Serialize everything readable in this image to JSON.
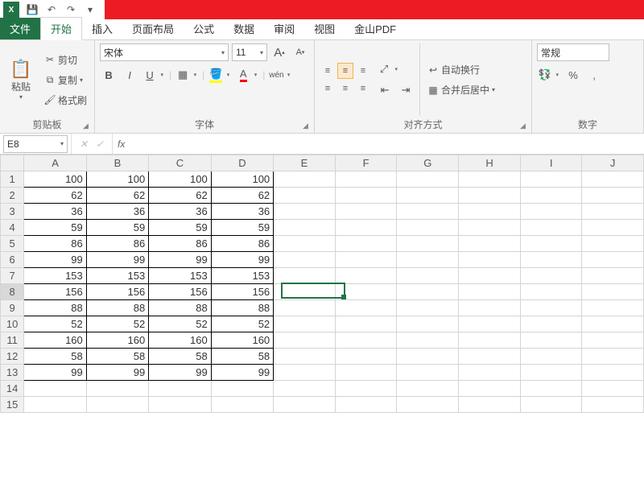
{
  "qat": {
    "save": "💾",
    "undo": "↶",
    "redo": "↷",
    "more": "▾"
  },
  "tabs": {
    "file": "文件",
    "items": [
      "开始",
      "插入",
      "页面布局",
      "公式",
      "数据",
      "审阅",
      "视图",
      "金山PDF"
    ],
    "active": 0
  },
  "ribbon": {
    "clipboard": {
      "label": "剪贴板",
      "paste": "粘贴",
      "cut": "剪切",
      "copy": "复制",
      "painter": "格式刷"
    },
    "font": {
      "label": "字体",
      "name": "宋体",
      "size": "11",
      "bold": "B",
      "italic": "I",
      "underline": "U",
      "pinyin": "wén"
    },
    "align": {
      "label": "对齐方式",
      "wrap": "自动换行",
      "merge": "合并后居中"
    },
    "number": {
      "label": "数字",
      "format": "常规",
      "percent": "%",
      "comma": ","
    }
  },
  "formula_bar": {
    "cell_ref": "E8",
    "value": ""
  },
  "grid": {
    "columns": [
      "A",
      "B",
      "C",
      "D",
      "E",
      "F",
      "G",
      "H",
      "I",
      "J"
    ],
    "row_count": 15,
    "selected_row": 8,
    "selected_col": 4,
    "data": [
      [
        100,
        100,
        100,
        100
      ],
      [
        62,
        62,
        62,
        62
      ],
      [
        36,
        36,
        36,
        36
      ],
      [
        59,
        59,
        59,
        59
      ],
      [
        86,
        86,
        86,
        86
      ],
      [
        99,
        99,
        99,
        99
      ],
      [
        153,
        153,
        153,
        153
      ],
      [
        156,
        156,
        156,
        156
      ],
      [
        88,
        88,
        88,
        88
      ],
      [
        52,
        52,
        52,
        52
      ],
      [
        160,
        160,
        160,
        160
      ],
      [
        58,
        58,
        58,
        58
      ],
      [
        99,
        99,
        99,
        99
      ]
    ]
  }
}
